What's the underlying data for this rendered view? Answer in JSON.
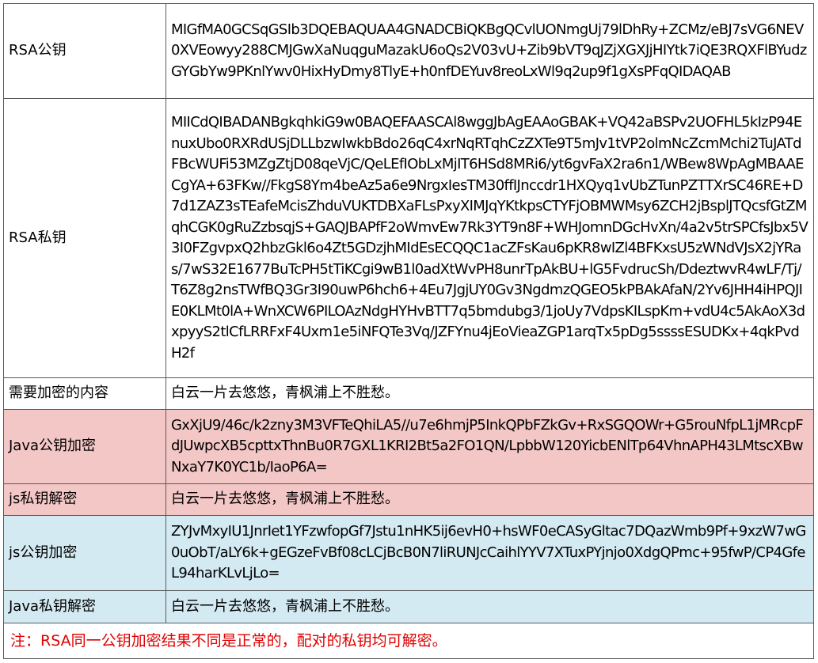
{
  "rows": {
    "public_key": {
      "label": "RSA公钥",
      "value": "MIGfMA0GCSqGSIb3DQEBAQUAA4GNADCBiQKBgQCvlUONmgUj79lDhRy+ZCMz/eBJ7sVG6NEV0XVEowyy288CMJGwXaNuqguMazakU6oQs2V03vU+Zib9bVT9qJZjXGXJjHIYtk7iQE3RQXFlBYudzGYGbYw9PKnlYwv0HixHyDmy8TlyE+h0nfDEYuv8reoLxWl9q2up9f1gXsPFqQIDAQAB"
    },
    "private_key": {
      "label": "RSA私钥",
      "value": "MIICdQIBADANBgkqhkiG9w0BAQEFAASCAl8wggJbAgEAAoGBAK+VQ42aBSPv2UOFHL5kIzP94EnuxUbo0RXRdUSjDLLbzwIwkbBdo26qC4xrNqRTqhCzZXTe9T5mJv1tVP2olmNcZcmMchi2TuJATdFBcWUFi53MZgZtjD08qeVjC/QeLEfIObLxMjIT6HSd8MRi6/yt6gvFaX2ra6n1/WBew8WpAgMBAAECgYA+63FKw//FkgS8Ym4beAz5a6e9NrgxIesTM30ffIJnccdr1HXQyq1vUbZTunPZTTXrSC46RE+D7d1ZAZ3sTEafeMcisZhduVUKTDBXaFLsPxyXIMJqYKtkpsCTYFjOBMWMsy6ZCH2jBsplJTQcsfGtZMqhCGK0gRuZzbsqjS+GAQJBAPfF2oWmvEw7Rk3YT9n8F+WHJomnDGcHvXn/4a2v5trSPCfsJbx5V3I0FZgvpxQ2hbzGkl6o4Zt5GDzjhMIdEsECQQC1acZFsKau6pKR8wIZl4BFKxsU5zWNdVJsX2jYRas/7wS32E1677BuTcPH5tTiKCgi9wB1l0adXtWvPH8unrTpAkBU+lG5FvdrucSh/DdeztwvR4wLF/Tj/T6Z8g2nsTWfBQ3Gr3I90uwP6hch6+4Eu7JgjUY0Gv3NgdmzQGEO5kPBAkAfaN/2Yv6JHH4iHPQJIE0KLMt0lA+WnXCW6PILOAzNdgHYHvBTT7q5bmdubg3/1joUy7VdpsKILspKm+vdU4c5AkAoX3dxpyyS2tlCfLRRFxF4Uxm1e5iNFQTe3Vq/JZFYnu4jEoVieaZGP1arqTx5pDg5ssssESUDKx+4qkPvdH2f"
    },
    "plaintext": {
      "label": "需要加密的内容",
      "value": "白云一片去悠悠，青枫浦上不胜愁。"
    },
    "java_pub_encrypt": {
      "label": "Java公钥加密",
      "value": "GxXjU9/46c/k2zny3M3VFTeQhiLA5//u7e6hmjP5InkQPbFZkGv+RxSGQOWr+G5rouNfpL1jMRcpFdJUwpcXB5cpttxThnBu0R7GXL1KRI2Bt5a2FO1QN/LpbbW120YicbENlTp64VhnAPH43LMtscXBwNxaY7K0YC1b/IaoP6A="
    },
    "js_priv_decrypt": {
      "label": "js私钥解密",
      "value": "白云一片去悠悠，青枫浦上不胜愁。"
    },
    "js_pub_encrypt": {
      "label": "js公钥加密",
      "value": "ZYJvMxyIU1JnrIet1YFzwfopGf7Jstu1nHK5ij6evH0+hsWF0eCASyGltac7DQazWmb9Pf+9xzW7wG0uObT/aLY6k+gEGzeFvBf08cLCjBcB0N7liRUNJcCaihlYYV7XTuxPYjnjo0XdgQPmc+95fwP/CP4GfeL94harKLvLjLo="
    },
    "java_priv_decrypt": {
      "label": "Java私钥解密",
      "value": "白云一片去悠悠，青枫浦上不胜愁。"
    }
  },
  "note": "注：RSA同一公钥加密结果不同是正常的，配对的私钥均可解密。",
  "colors": {
    "row_red_bg": "#f4c7c7",
    "row_blue_bg": "#d4eaf2",
    "note_text": "#e00000",
    "border": "#595959"
  }
}
